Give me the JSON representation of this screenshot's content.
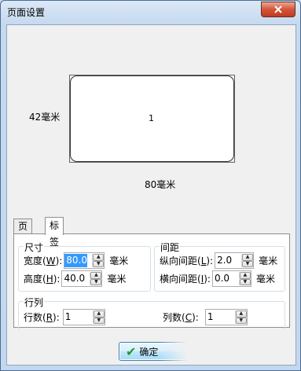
{
  "window": {
    "title": "页面设置"
  },
  "preview": {
    "card_text": "1",
    "height_label": "42毫米",
    "width_label": "80毫米"
  },
  "tabs": [
    {
      "label": "页面",
      "active": false
    },
    {
      "label": "标签",
      "active": true
    }
  ],
  "size_group": {
    "title": "尺寸",
    "width": {
      "label_prefix": "宽度(",
      "key": "W",
      "label_suffix": "):",
      "value": "80.0",
      "unit": "毫米"
    },
    "height": {
      "label_prefix": "高度(",
      "key": "H",
      "label_suffix": "):",
      "value": "40.0",
      "unit": "毫米"
    }
  },
  "spacing_group": {
    "title": "间距",
    "vertical": {
      "label_prefix": "纵向间距(",
      "key": "L",
      "label_suffix": "):",
      "value": "2.0",
      "unit": "毫米"
    },
    "horizontal": {
      "label_prefix": "横向间距(",
      "key": "I",
      "label_suffix": "):",
      "value": "0.0",
      "unit": "毫米"
    }
  },
  "rowcol_group": {
    "title": "行列",
    "rows": {
      "label_prefix": "行数(",
      "key": "R",
      "label_suffix": "):",
      "value": "1"
    },
    "cols": {
      "label_prefix": "列数(",
      "key": "C",
      "label_suffix": "):",
      "value": "1"
    }
  },
  "ok_button": {
    "label": "确定"
  },
  "colors": {
    "accent": "#3399ff",
    "close": "#c23a1f",
    "check": "#1f9a2b"
  }
}
